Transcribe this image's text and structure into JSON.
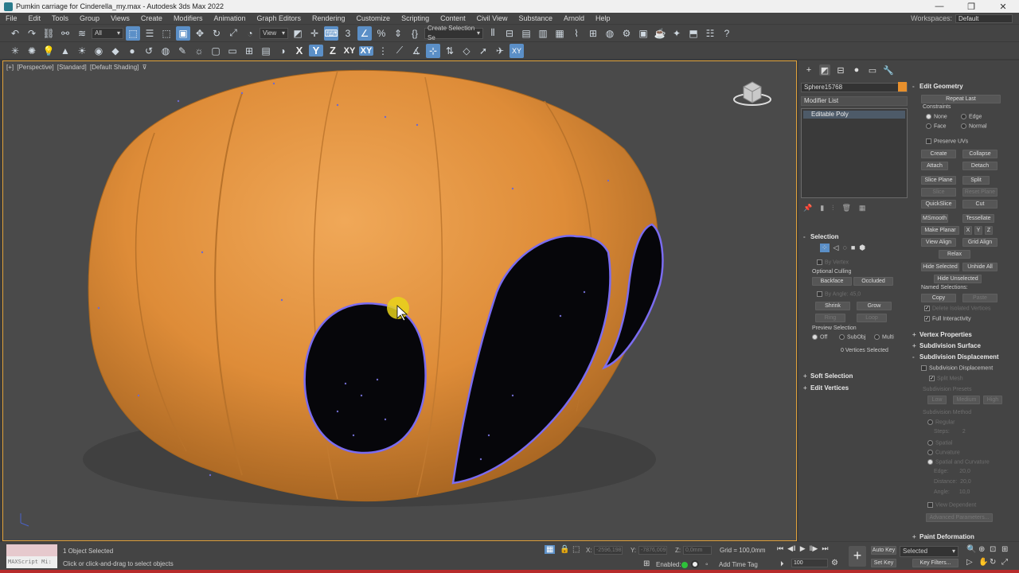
{
  "window": {
    "title": "Pumkin carriage for Cinderella_my.max - Autodesk 3ds Max 2022",
    "controls": [
      "—",
      "❐",
      "✕"
    ]
  },
  "menu": {
    "items": [
      "File",
      "Edit",
      "Tools",
      "Group",
      "Views",
      "Create",
      "Modifiers",
      "Animation",
      "Graph Editors",
      "Rendering",
      "Customize",
      "Scripting",
      "Content",
      "Civil View",
      "Substance",
      "Arnold",
      "Help"
    ],
    "workspace_label": "Workspaces:",
    "workspace_value": "Default"
  },
  "toolbar": {
    "filter_value": "All",
    "refcoord_value": "View",
    "selection_set": "Create Selection Se",
    "axis_x": "X",
    "axis_y": "Y",
    "axis_z": "Z",
    "axis_xy": "XY",
    "axis_xy2": "XY"
  },
  "viewport": {
    "label_plus": "[+]",
    "label_view": "[Perspective]",
    "label_shading_mode": "[Standard]",
    "label_shading": "[Default Shading]",
    "colors": {
      "pumpkin": "#e08e36",
      "hole": "#06060a",
      "selection_edge": "#7b6cf0",
      "background": "#4a4a4a"
    }
  },
  "command_panel": {
    "object_name": "Sphere15768",
    "object_color": "#e8902c",
    "modifier_list": "Modifier List",
    "stack_item": "Editable Poly",
    "selection": {
      "title": "Selection",
      "by_vertex": "By Vertex",
      "optional_culling": "Optional Culling",
      "backface": "Backface",
      "occluded": "Occluded",
      "by_angle": "By Angle:",
      "by_angle_value": "45,0",
      "shrink": "Shrink",
      "grow": "Grow",
      "ring": "Ring",
      "loop": "Loop",
      "preview_selection": "Preview Selection",
      "preview_off": "Off",
      "preview_subobj": "SubObj",
      "preview_multi": "Multi",
      "vertices_selected": "0 Vertices Selected"
    },
    "soft_selection": "Soft Selection",
    "edit_vertices": "Edit Vertices",
    "edit_geometry": {
      "title": "Edit Geometry",
      "repeat_last": "Repeat Last",
      "constraints": "Constraints",
      "none": "None",
      "edge": "Edge",
      "face": "Face",
      "normal": "Normal",
      "preserve_uvs": "Preserve UVs",
      "create": "Create",
      "collapse": "Collapse",
      "attach": "Attach",
      "detach": "Detach",
      "slice_plane": "Slice Plane",
      "split": "Split",
      "slice": "Slice",
      "reset_plane": "Reset Plane",
      "quickslice": "QuickSlice",
      "cut": "Cut",
      "msmooth": "MSmooth",
      "tessellate": "Tessellate",
      "make_planar": "Make Planar",
      "x": "X",
      "y": "Y",
      "z": "Z",
      "view_align": "View Align",
      "grid_align": "Grid Align",
      "relax": "Relax",
      "hide_selected": "Hide Selected",
      "unhide_all": "Unhide All",
      "hide_unselected": "Hide Unselected",
      "named_selections": "Named Selections:",
      "copy": "Copy",
      "paste": "Paste",
      "delete_isolated": "Delete Isolated Vertices",
      "full_interactivity": "Full Interactivity"
    },
    "vertex_properties": "Vertex Properties",
    "subdivision_surface": "Subdivision Surface",
    "subdivision_displacement": {
      "title": "Subdivision Displacement",
      "checkbox": "Subdivision Displacement",
      "split_mesh": "Split Mesh",
      "presets": "Subdivision Presets",
      "low": "Low",
      "medium": "Medium",
      "high": "High",
      "method": "Subdivision Method",
      "regular": "Regular",
      "steps": "Steps:",
      "steps_value": "2",
      "spatial": "Spatial",
      "curvature": "Curvature",
      "spatial_and_curvature": "Spatial and Curvature",
      "edge": "Edge:",
      "edge_value": "20,0",
      "distance": "Distance:",
      "distance_value": "20,0",
      "angle": "Angle:",
      "angle_value": "10,0",
      "view_dependent": "View Dependent",
      "advanced": "Advanced Parameters..."
    },
    "paint_deformation": "Paint Deformation"
  },
  "status": {
    "maxscript": "MAXScript Mi:",
    "objects_selected": "1 Object Selected",
    "prompt": "Click or click-and-drag to select objects",
    "x_label": "X:",
    "x_value": "-2596,198",
    "y_label": "Y:",
    "y_value": "-7876,009",
    "z_label": "Z:",
    "z_value": "0,0mm",
    "grid": "Grid = 100,0mm",
    "enabled": "Enabled:",
    "add_time_tag": "Add Time Tag",
    "frame": "100",
    "auto_key": "Auto Key",
    "set_key": "Set Key",
    "key_selected": "Selected",
    "key_filters": "Key Filters..."
  }
}
